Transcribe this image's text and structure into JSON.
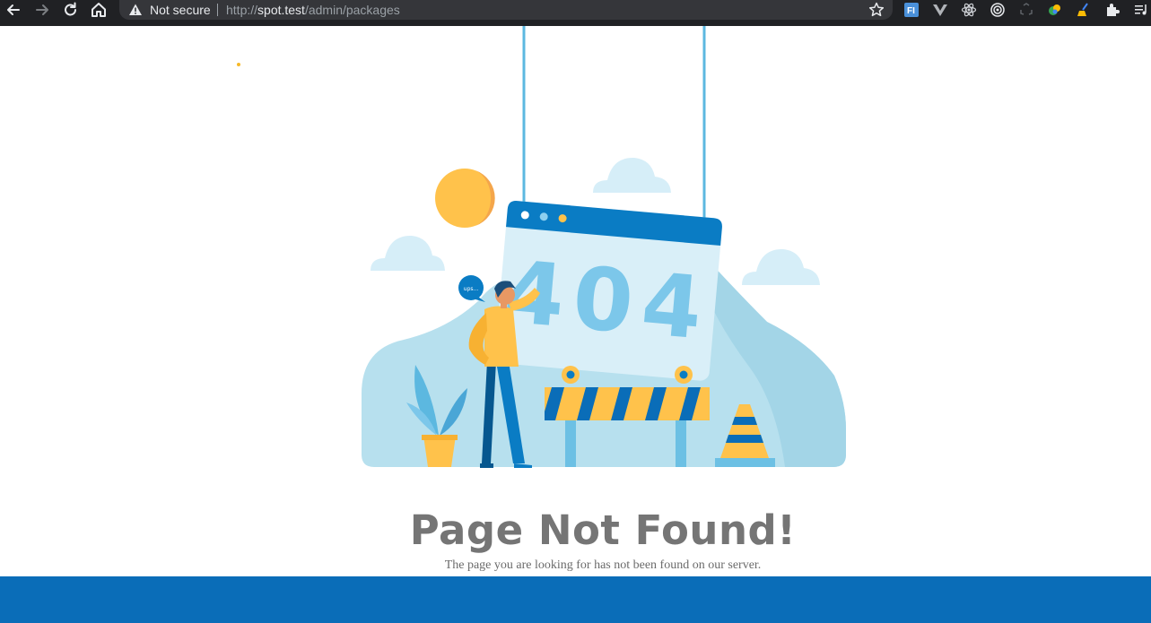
{
  "browser": {
    "security_label": "Not secure",
    "url_scheme": "http://",
    "url_host": "spot.test",
    "url_path": "/admin/packages",
    "extensions": [
      "fi-extension-icon",
      "vue-devtools-icon",
      "react-devtools-icon",
      "target-extension-icon",
      "recycle-extension-icon",
      "color-extension-icon",
      "broom-extension-icon",
      "puzzle-extensions-icon",
      "media-control-icon"
    ]
  },
  "page": {
    "error_code": "404",
    "bubble_text": "ups...",
    "title": "Page Not Found!",
    "subtitle": "The page you are looking for has not been found on our server."
  },
  "colors": {
    "footer": "#0a6db8",
    "accent_blue": "#0a7cc4",
    "light_blue": "#a8d9ec",
    "orange": "#f7b928"
  }
}
